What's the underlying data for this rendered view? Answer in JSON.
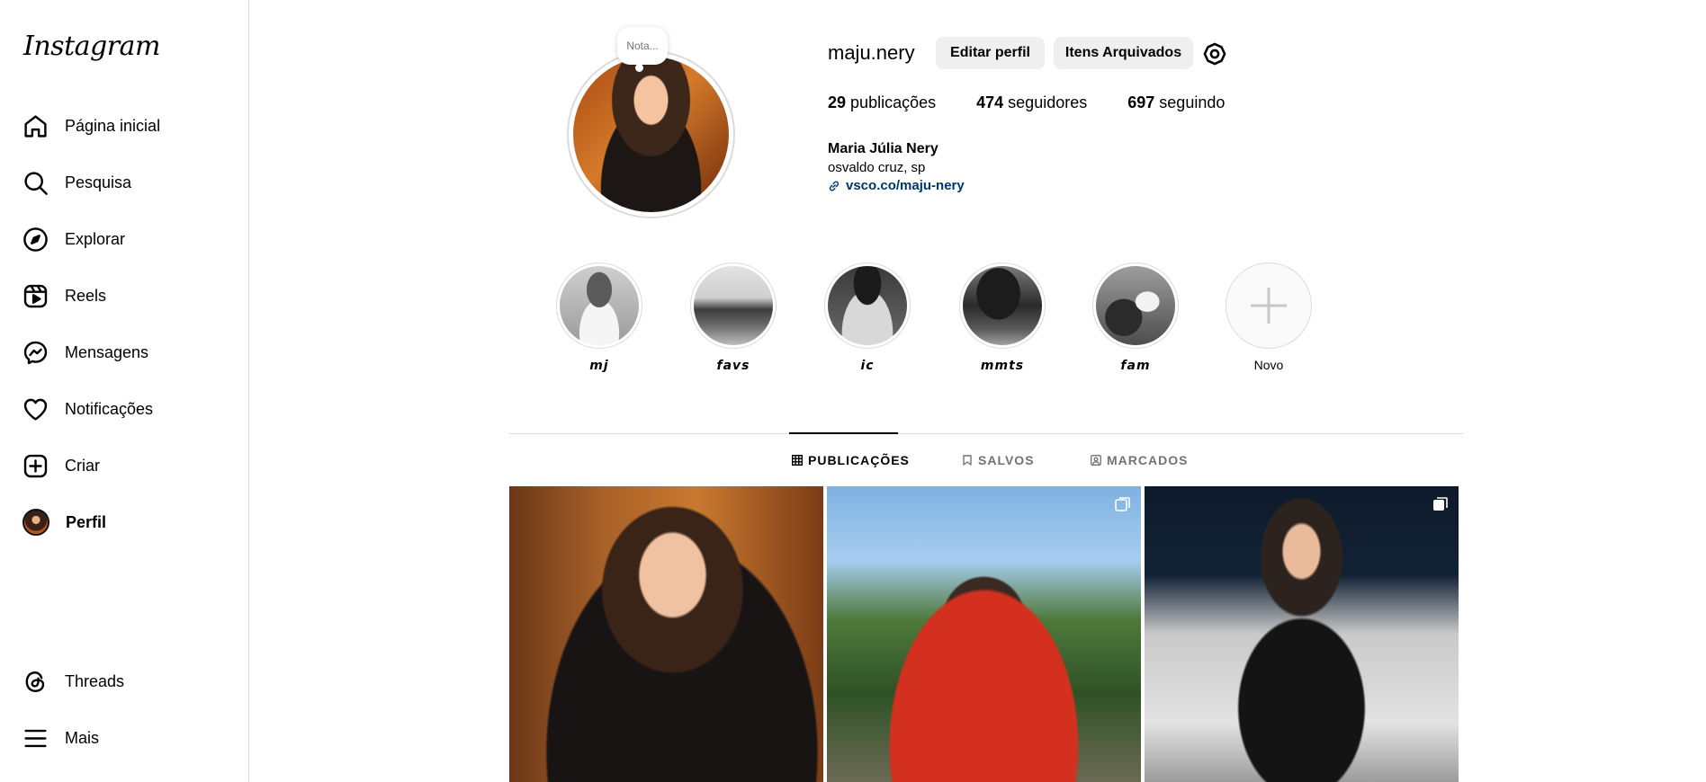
{
  "app": {
    "logo": "Instagram"
  },
  "sidebar": {
    "items": [
      {
        "label": "Página inicial",
        "icon": "home-icon"
      },
      {
        "label": "Pesquisa",
        "icon": "search-icon"
      },
      {
        "label": "Explorar",
        "icon": "compass-icon"
      },
      {
        "label": "Reels",
        "icon": "reels-icon"
      },
      {
        "label": "Mensagens",
        "icon": "messenger-icon"
      },
      {
        "label": "Notificações",
        "icon": "heart-icon"
      },
      {
        "label": "Criar",
        "icon": "plus-square-icon"
      },
      {
        "label": "Perfil",
        "icon": "avatar"
      }
    ],
    "bottom": [
      {
        "label": "Threads",
        "icon": "threads-icon"
      },
      {
        "label": "Mais",
        "icon": "menu-icon"
      }
    ]
  },
  "profile": {
    "note": "Nota...",
    "username": "maju.nery",
    "edit_button": "Editar perfil",
    "archive_button": "Itens Arquivados",
    "stats": {
      "posts_count": "29",
      "posts_label": "publicações",
      "followers_count": "474",
      "followers_label": "seguidores",
      "following_count": "697",
      "following_label": "seguindo"
    },
    "full_name": "Maria Júlia Nery",
    "bio": "osvaldo cruz, sp",
    "link": "vsco.co/maju-nery"
  },
  "highlights": [
    {
      "label": "𝙢𝙟"
    },
    {
      "label": "𝙛𝙖𝙫𝙨"
    },
    {
      "label": "𝙞𝙘"
    },
    {
      "label": "𝙢𝙢𝙩𝙨"
    },
    {
      "label": "𝙛𝙖𝙢"
    },
    {
      "label": "Novo"
    }
  ],
  "tabs": [
    {
      "label": "PUBLICAÇÕES",
      "active": true
    },
    {
      "label": "SALVOS",
      "active": false
    },
    {
      "label": "MARCADOS",
      "active": false
    }
  ],
  "colors": {
    "link": "#00376b",
    "border": "#dbdbdb",
    "button_bg": "#efefef",
    "muted": "#737373"
  }
}
